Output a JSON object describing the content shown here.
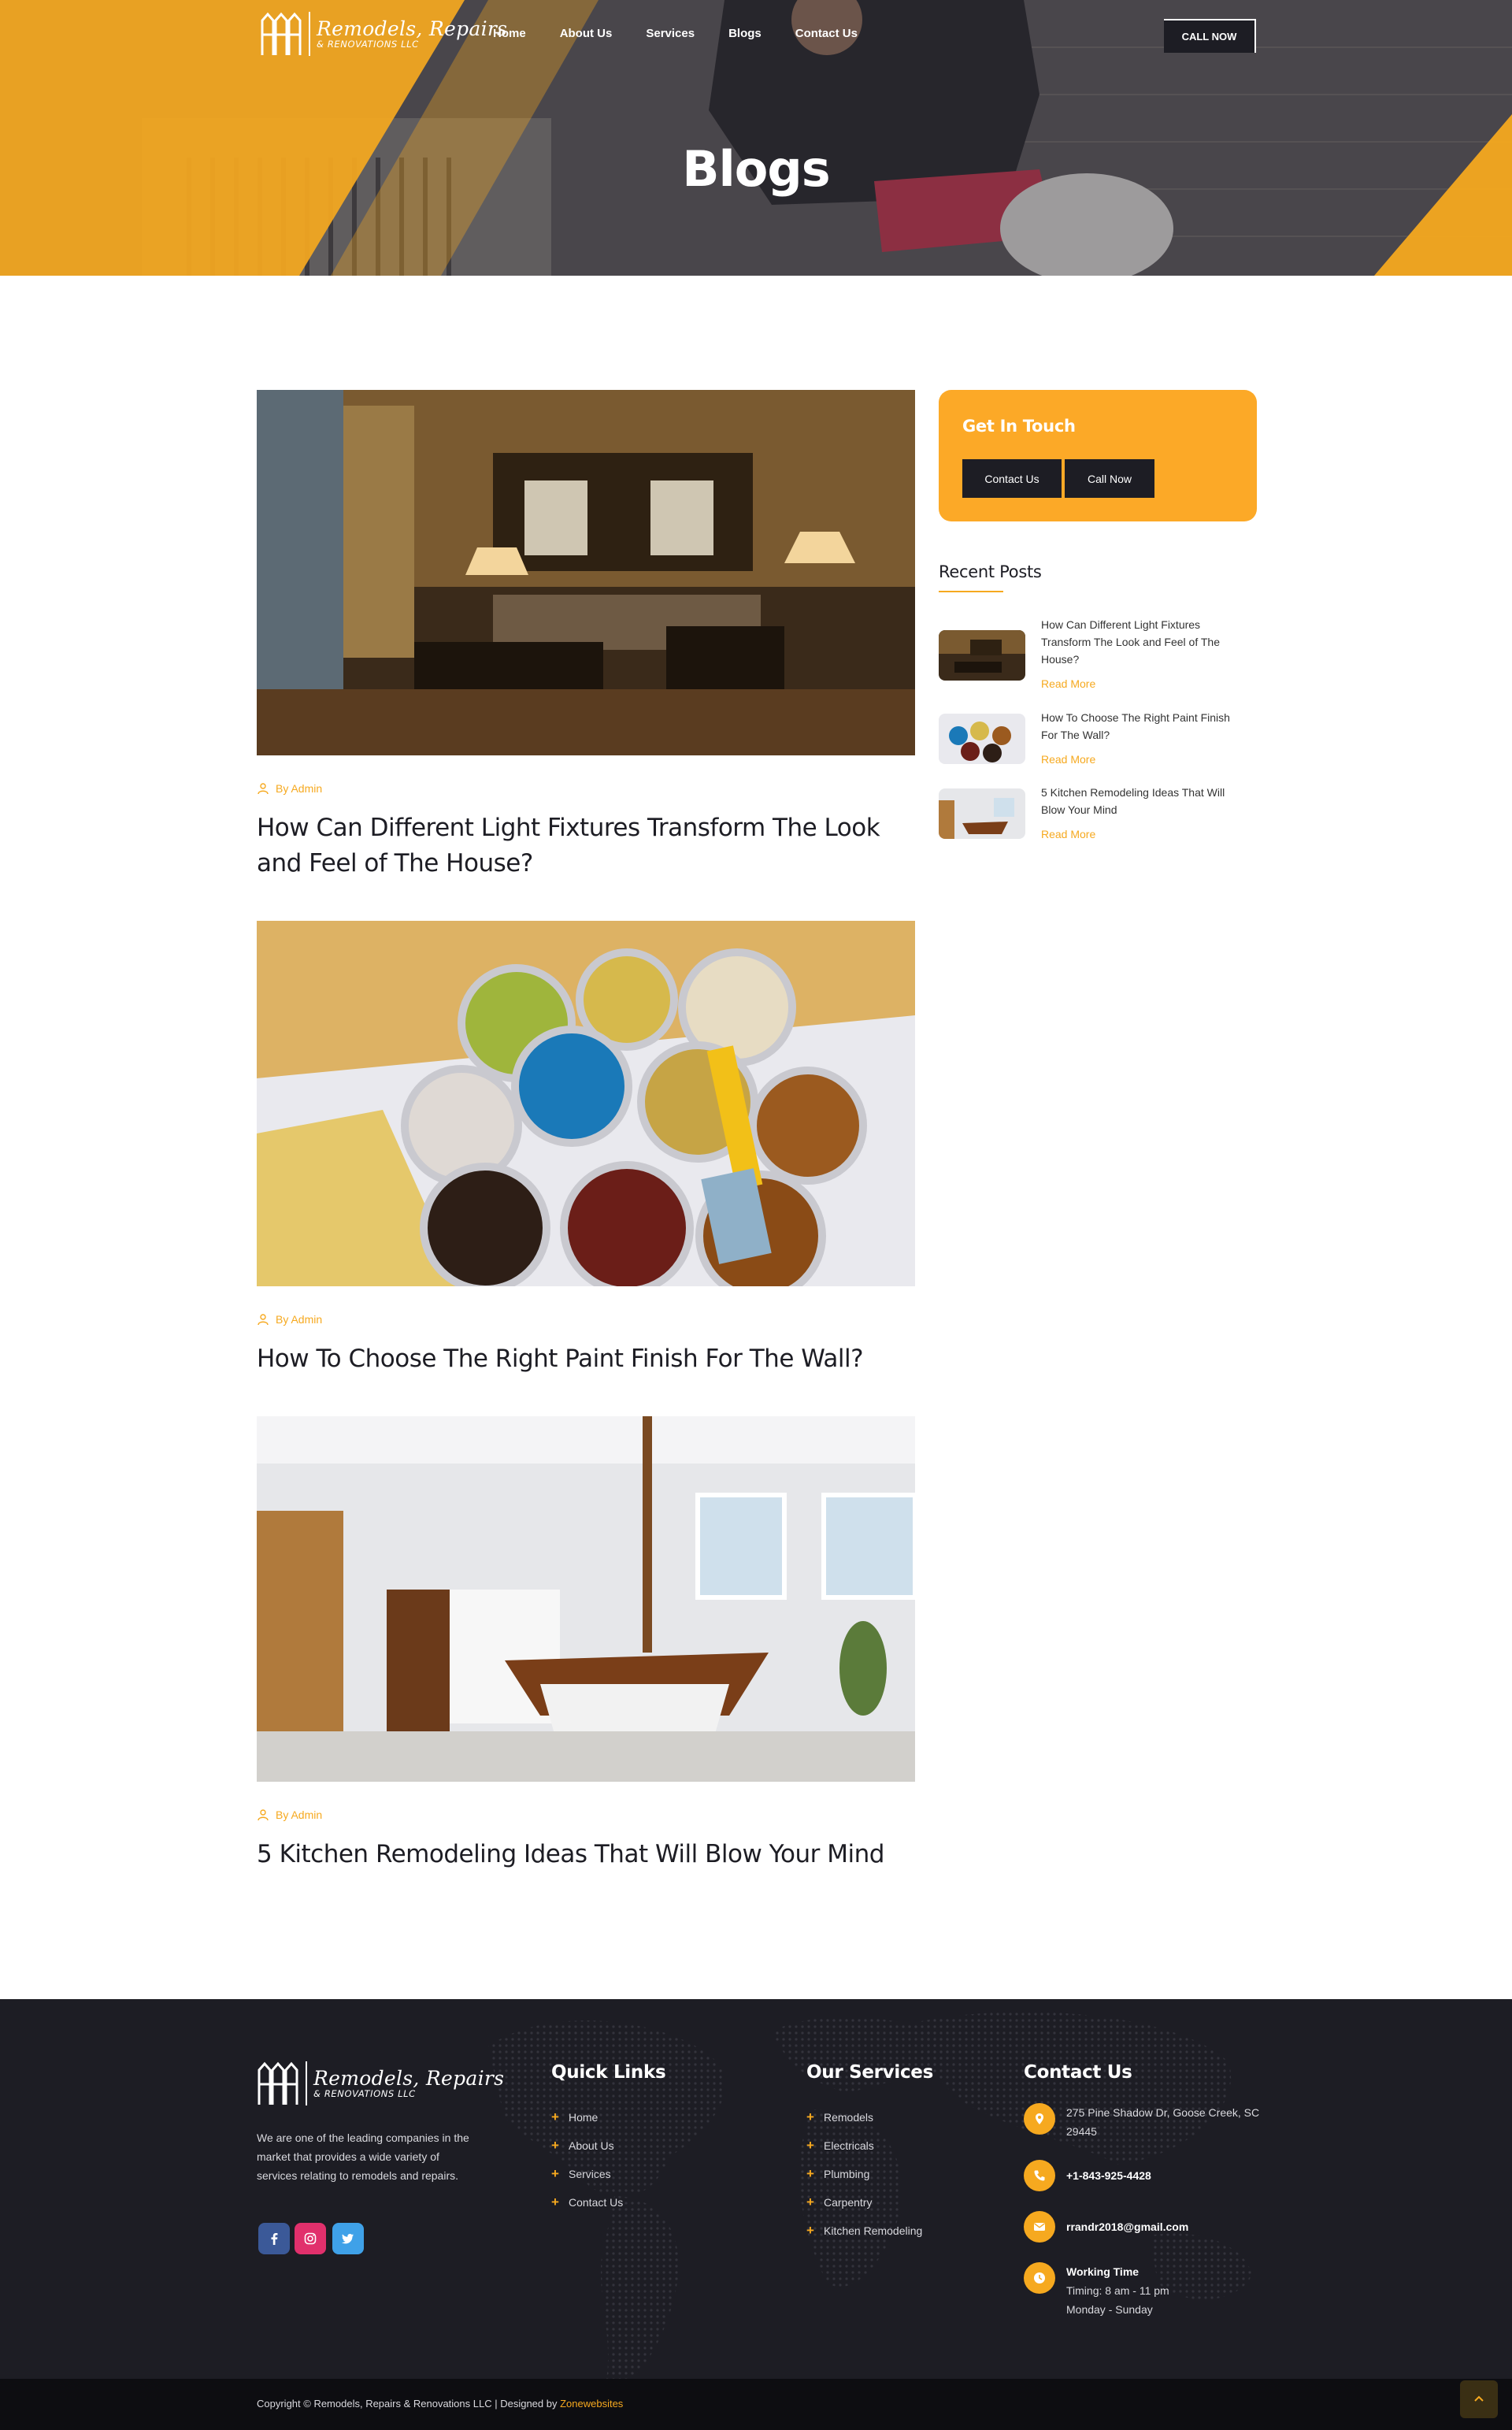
{
  "brand": {
    "name_line1": "Remodels, Repairs",
    "name_line2": "& RENOVATIONS LLC",
    "accent_color": "#f6a91f",
    "dark_color": "#1d1d24"
  },
  "nav": {
    "items": [
      "Home",
      "About Us",
      "Services",
      "Blogs",
      "Contact Us"
    ],
    "cta_label": "CALL NOW"
  },
  "hero": {
    "title": "Blogs"
  },
  "posts": [
    {
      "author": "By Admin",
      "title": "How Can Different Light Fixtures Transform The Look and Feel of The House?"
    },
    {
      "author": "By Admin",
      "title": "How To Choose The Right Paint Finish For The Wall?"
    },
    {
      "author": "By Admin",
      "title": "5 Kitchen Remodeling Ideas That Will Blow Your Mind"
    }
  ],
  "sidebar": {
    "get_in_touch": {
      "title": "Get In Touch",
      "contact_label": "Contact Us",
      "call_label": "Call Now"
    },
    "recent_title": "Recent Posts",
    "read_more": "Read More",
    "recent": [
      {
        "title": "How Can Different Light Fixtures Transform The Look and Feel of The House?",
        "read_more": "Read More"
      },
      {
        "title": "How To Choose The Right Paint Finish For The Wall?",
        "read_more": "Read More"
      },
      {
        "title": "5 Kitchen Remodeling Ideas That Will Blow Your Mind",
        "read_more": "Read More"
      }
    ]
  },
  "footer": {
    "description": "We are one of the leading companies in the market that provides a wide variety of services relating to remodels and repairs.",
    "social": [
      "facebook-icon",
      "instagram-icon",
      "twitter-icon"
    ],
    "quick_links_title": "Quick Links",
    "quick_links": [
      "Home",
      "About Us",
      "Services",
      "Contact Us"
    ],
    "services_title": "Our Services",
    "services": [
      "Remodels",
      "Electricals",
      "Plumbing",
      "Carpentry",
      "Kitchen Remodeling"
    ],
    "contact_title": "Contact Us",
    "address": "275 Pine Shadow Dr, Goose Creek, SC 29445",
    "phone": "+1-843-925-4428",
    "email": "rrandr2018@gmail.com",
    "working_title": "Working Time",
    "working_hours": "Timing: 8 am - 11 pm",
    "working_days": "Monday - Sunday",
    "copyright": "Copyright © Remodels, Repairs & Renovations LLC | Designed by ",
    "designer": "Zonewebsites"
  }
}
